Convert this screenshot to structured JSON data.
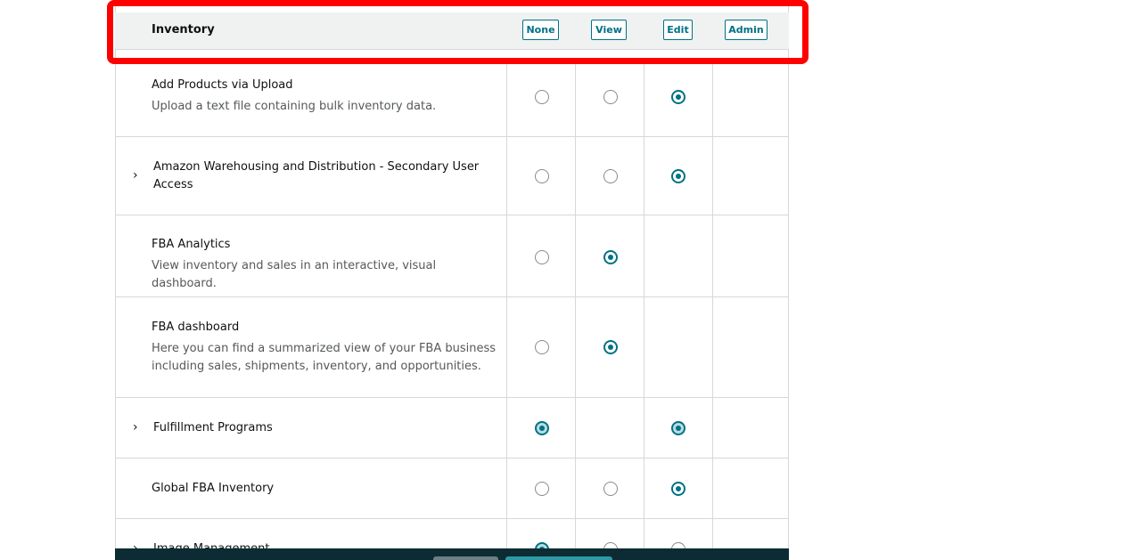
{
  "header": {
    "title": "Inventory",
    "buttons": {
      "none": "None",
      "view": "View",
      "edit": "Edit",
      "admin": "Admin"
    }
  },
  "rows": [
    {
      "title": "Add Products via Upload",
      "desc": "Upload a text file containing bulk inventory data."
    },
    {
      "title": "Amazon Warehousing and Distribution - Secondary User",
      "title2": "Access",
      "expand": "›"
    },
    {
      "title": "FBA Analytics",
      "desc": "View inventory and sales in an interactive, visual dashboard."
    },
    {
      "title": "FBA dashboard",
      "desc": "Here you can find a summarized view of your FBA business",
      "desc2": "including sales, shipments, inventory, and opportunities."
    },
    {
      "title": "Fulfillment Programs",
      "expand": "›"
    },
    {
      "title": "Global FBA Inventory"
    },
    {
      "title": "Image Management",
      "expand": "›"
    }
  ],
  "colors": {
    "accent": "#007185",
    "highlight": "#ff0000",
    "footer": "#0d2b33"
  }
}
